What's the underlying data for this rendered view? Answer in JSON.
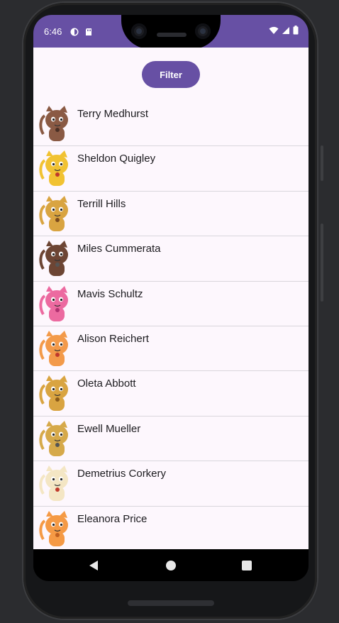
{
  "status_bar": {
    "time": "6:46",
    "bg_color": "#6750a4"
  },
  "toolbar": {
    "filter_label": "Filter"
  },
  "list": {
    "items": [
      {
        "name": "Terry Medhurst",
        "avatar_color": "#8a5a44",
        "accent": "#4a2f24"
      },
      {
        "name": "Sheldon Quigley",
        "avatar_color": "#f1c232",
        "accent": "#c0392b"
      },
      {
        "name": "Terrill Hills",
        "avatar_color": "#d9a441",
        "accent": "#7a4a1c"
      },
      {
        "name": "Miles Cummerata",
        "avatar_color": "#6d4534",
        "accent": "#555555"
      },
      {
        "name": "Mavis Schultz",
        "avatar_color": "#ec6aa0",
        "accent": "#b03070"
      },
      {
        "name": "Alison Reichert",
        "avatar_color": "#f39a4a",
        "accent": "#c0392b"
      },
      {
        "name": "Oleta Abbott",
        "avatar_color": "#d9a441",
        "accent": "#8a5a18"
      },
      {
        "name": "Ewell Mueller",
        "avatar_color": "#d6a94a",
        "accent": "#555555"
      },
      {
        "name": "Demetrius Corkery",
        "avatar_color": "#f4e6c4",
        "accent": "#c0392b"
      },
      {
        "name": "Eleanora Price",
        "avatar_color": "#f59a45",
        "accent": "#c06020"
      }
    ]
  },
  "icons": {
    "status": [
      "notification-icon",
      "sd-card-icon",
      "wifi-icon",
      "signal-icon",
      "battery-icon"
    ],
    "nav": [
      "back-icon",
      "home-icon",
      "recents-icon"
    ]
  }
}
